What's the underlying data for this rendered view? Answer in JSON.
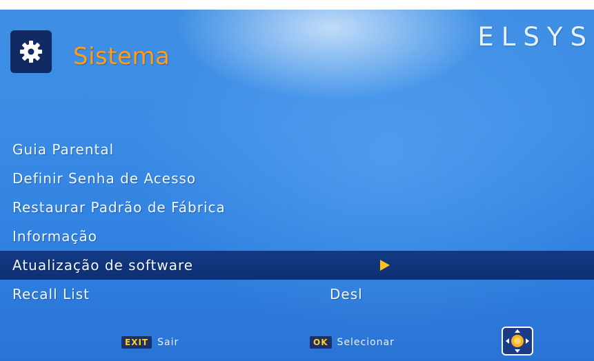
{
  "header": {
    "title": "Sistema",
    "brand": "ELSYS",
    "icon": "gear-icon"
  },
  "menu": {
    "items": [
      {
        "label": "Guia Parental",
        "value": ""
      },
      {
        "label": "Definir Senha de Acesso",
        "value": ""
      },
      {
        "label": "Restaurar Padrão de Fábrica",
        "value": ""
      },
      {
        "label": "Informação",
        "value": ""
      },
      {
        "label": "Atualização de software",
        "value": "",
        "selected": true
      },
      {
        "label": "Recall List",
        "value": "Desl"
      }
    ]
  },
  "footer": {
    "exit_key": "EXIT",
    "exit_label": "Sair",
    "ok_key": "OK",
    "ok_label": "Selecionar",
    "nav_icon": "dpad-icon"
  },
  "colors": {
    "title": "#ff9c1a",
    "selection": "#0e2f74",
    "accent_arrow": "#ffc21a",
    "background": "#3b8ce6"
  }
}
